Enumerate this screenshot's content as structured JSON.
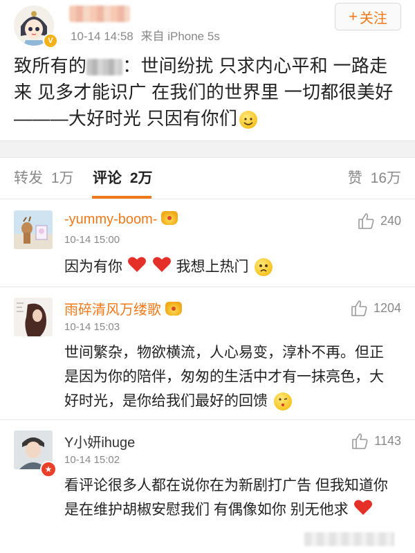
{
  "post": {
    "user_name": "██",
    "timestamp": "10-14 14:58",
    "source": "来自 iPhone 5s",
    "follow_label": "关注",
    "text_before": "致所有的",
    "text_after": "：世间纷扰 只求内心平和 一路走来 见多才能识广 在我们的世界里 一切都很美好———大好时光 只因有你们"
  },
  "tabs": {
    "repost_label": "转发",
    "repost_count": "1万",
    "comment_label": "评论",
    "comment_count": "2万",
    "like_label": "赞",
    "like_count": "16万"
  },
  "comments": [
    {
      "name": "-yummy-boom-",
      "time": "10-14 15:00",
      "likes": "240",
      "text": "因为有你",
      "text_tail": "我想上热门"
    },
    {
      "name": "雨碎清风万缕歌",
      "time": "10-14 15:03",
      "likes": "1204",
      "text": "世间繁杂，物欲横流，人心易变，淳朴不再。但正是因为你的陪伴，匆匆的生活中才有一抹亮色，大好时光，是你给我们最好的回馈"
    },
    {
      "name": "Y小妍ihuge",
      "time": "10-14 15:02",
      "likes": "1143",
      "text": "看评论很多人都在说你在为新剧打广告 但我知道你是在维护胡椒安慰我们 有偶像如你 别无他求"
    }
  ],
  "colors": {
    "accent": "#f07818",
    "heart": "#e5302a",
    "muted": "#888888"
  }
}
